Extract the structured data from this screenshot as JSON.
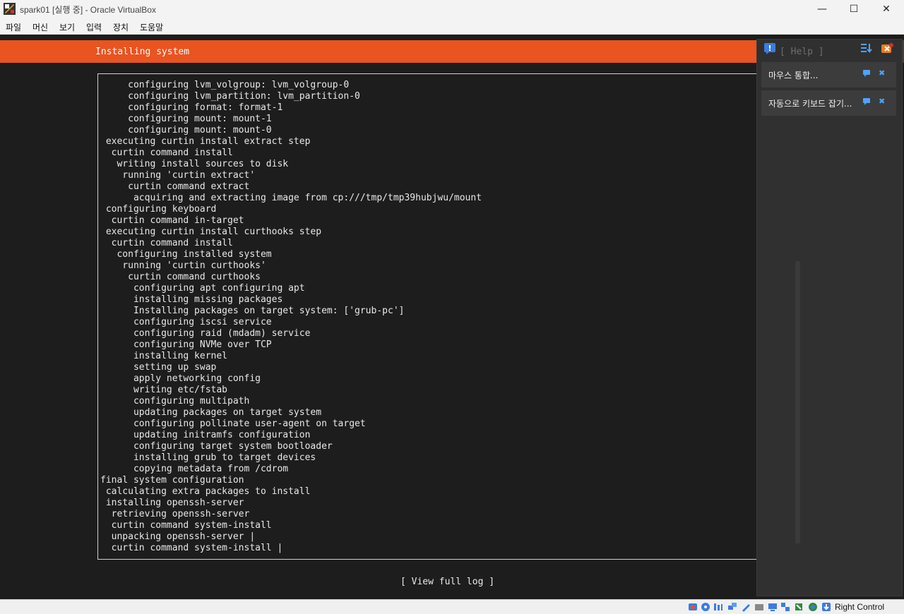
{
  "window": {
    "title": "spark01 [실행 중] - Oracle VirtualBox",
    "minimize_glyph": "—",
    "maximize_glyph": "☐",
    "close_glyph": "✕"
  },
  "menu": [
    "파일",
    "머신",
    "보기",
    "입력",
    "장치",
    "도움말"
  ],
  "installer": {
    "header_title": "Installing system",
    "help_label": "[ Help ]",
    "view_full_log": "[ View full log ]",
    "log_lines": [
      "     configuring lvm_volgroup: lvm_volgroup-0",
      "     configuring lvm_partition: lvm_partition-0",
      "     configuring format: format-1",
      "     configuring mount: mount-1",
      "     configuring mount: mount-0",
      " executing curtin install extract step",
      "  curtin command install",
      "   writing install sources to disk",
      "    running 'curtin extract'",
      "     curtin command extract",
      "      acquiring and extracting image from cp:///tmp/tmp39hubjwu/mount",
      " configuring keyboard",
      "  curtin command in-target",
      " executing curtin install curthooks step",
      "  curtin command install",
      "   configuring installed system",
      "    running 'curtin curthooks'",
      "     curtin command curthooks",
      "      configuring apt configuring apt",
      "      installing missing packages",
      "      Installing packages on target system: ['grub-pc']",
      "      configuring iscsi service",
      "      configuring raid (mdadm) service",
      "      configuring NVMe over TCP",
      "      installing kernel",
      "      setting up swap",
      "      apply networking config",
      "      writing etc/fstab",
      "      configuring multipath",
      "      updating packages on target system",
      "      configuring pollinate user-agent on target",
      "      updating initramfs configuration",
      "      configuring target system bootloader",
      "      installing grub to target devices",
      "      copying metadata from /cdrom",
      "final system configuration",
      " calculating extra packages to install",
      " installing openssh-server",
      "  retrieving openssh-server",
      "  curtin command system-install",
      "  unpacking openssh-server |",
      "  curtin command system-install |"
    ]
  },
  "notifications": {
    "items": [
      {
        "text": "마우스 통합...",
        "close_glyph": "✖"
      },
      {
        "text": "자동으로 키보드 잡기...",
        "close_glyph": "✖"
      }
    ]
  },
  "statusbar": {
    "host_key": "Right Control",
    "icons": [
      "optical-drive-icon",
      "cd-icon",
      "audio-icon",
      "network-icon",
      "usb-icon",
      "shared-folders-icon",
      "display-icon",
      "video-capture-icon",
      "cpu-icon",
      "vt-icon",
      "mouse-integration-icon",
      "keyboard-capture-icon"
    ]
  },
  "colors": {
    "header_orange": "#e95420",
    "terminal_bg": "#1d1d1d",
    "terminal_text": "#e8e8e8",
    "notif_close": "#4da3ff"
  }
}
